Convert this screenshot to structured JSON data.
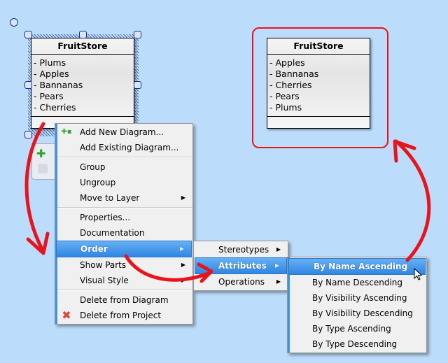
{
  "left_class": {
    "name": "FruitStore",
    "attributes": [
      "- Plums",
      "- Apples",
      "- Bannanas",
      "- Pears",
      "- Cherries"
    ]
  },
  "right_class": {
    "name": "FruitStore",
    "attributes": [
      "- Apples",
      "- Bannanas",
      "- Cherries",
      "- Pears",
      "- Plums"
    ]
  },
  "context_menu": {
    "items": [
      {
        "label": "Add New Diagram...",
        "icon": "add-diagram-icon"
      },
      {
        "label": "Add Existing Diagram..."
      },
      {
        "label": "Group"
      },
      {
        "label": "Ungroup"
      },
      {
        "label": "Move to Layer",
        "submenu": true
      },
      {
        "label": "Properties..."
      },
      {
        "label": "Documentation"
      },
      {
        "label": "Order",
        "submenu": true,
        "selected": true
      },
      {
        "label": "Show Parts",
        "submenu": true
      },
      {
        "label": "Visual Style",
        "submenu": true
      },
      {
        "label": "Delete from Diagram"
      },
      {
        "label": "Delete from Project",
        "icon": "delete-x-icon"
      }
    ]
  },
  "order_submenu": {
    "items": [
      {
        "label": "Stereotypes",
        "submenu": true
      },
      {
        "label": "Attributes",
        "submenu": true,
        "selected": true
      },
      {
        "label": "Operations",
        "submenu": true
      }
    ]
  },
  "attributes_submenu": {
    "items": [
      {
        "label": "By Name Ascending",
        "selected": true
      },
      {
        "label": "By Name Descending"
      },
      {
        "label": "By Visibility Ascending"
      },
      {
        "label": "By Visibility Descending"
      },
      {
        "label": "By Type Ascending"
      },
      {
        "label": "By Type Descending"
      }
    ]
  },
  "colors": {
    "canvas": "#bcdcfb",
    "annotation_red": "#e8141c",
    "menu_highlight": "#3c94e6"
  }
}
